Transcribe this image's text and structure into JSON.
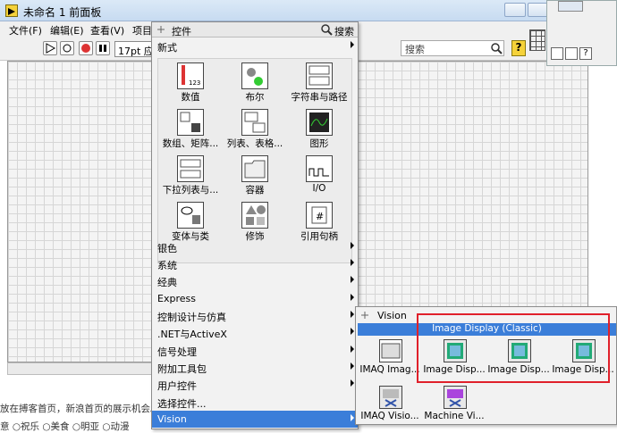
{
  "window": {
    "title": "未命名 1 前面板"
  },
  "menu": [
    "文件(F)",
    "编辑(E)",
    "查看(V)",
    "项目"
  ],
  "toolbar": {
    "font": "17pt 应"
  },
  "search": {
    "placeholder": "搜索"
  },
  "palette": {
    "title": "控件",
    "search_label": "搜索",
    "top_item": "新式",
    "tiles": [
      {
        "label": "数值",
        "icon": "numeric-icon"
      },
      {
        "label": "布尔",
        "icon": "boolean-icon"
      },
      {
        "label": "字符串与路径",
        "icon": "string-path-icon"
      },
      {
        "label": "数组、矩阵...",
        "icon": "array-icon"
      },
      {
        "label": "列表、表格...",
        "icon": "list-table-icon"
      },
      {
        "label": "图形",
        "icon": "graph-icon"
      },
      {
        "label": "下拉列表与...",
        "icon": "ring-enum-icon"
      },
      {
        "label": "容器",
        "icon": "container-icon"
      },
      {
        "label": "I/O",
        "icon": "io-icon"
      },
      {
        "label": "变体与类",
        "icon": "variant-icon"
      },
      {
        "label": "修饰",
        "icon": "decoration-icon"
      },
      {
        "label": "引用句柄",
        "icon": "refnum-icon"
      }
    ],
    "categories": [
      "银色",
      "系统",
      "经典",
      "Express",
      "控制设计与仿真",
      ".NET与ActiveX",
      "信号处理",
      "附加工具包",
      "用户控件",
      "选择控件...",
      "Vision"
    ],
    "selected": "Vision"
  },
  "vision": {
    "title": "Vision",
    "banner": "Image Display (Classic)",
    "tiles": [
      "IMAQ Imag...",
      "Image Disp...",
      "Image Disp...",
      "Image Disp...",
      "IMAQ Visio...",
      "Machine Vi..."
    ]
  },
  "status": {
    "line1": "放在搏客首页，新浪首页的展示机会。",
    "line2": "意  ○祝乐  ○美食  ○明亚  ○动漫"
  }
}
